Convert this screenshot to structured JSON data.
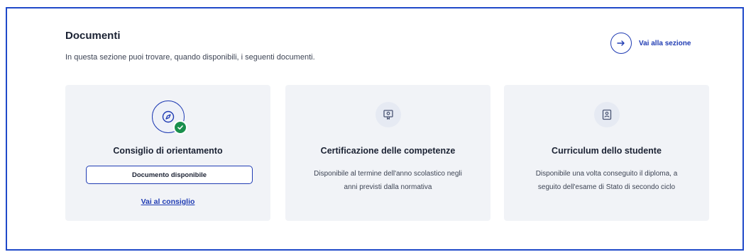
{
  "section": {
    "title": "Documenti",
    "subtitle": "In questa sezione puoi trovare, quando disponibili, i seguenti documenti.",
    "link_label": "Vai alla sezione"
  },
  "cards": [
    {
      "title": "Consiglio di orientamento",
      "status_label": "Documento disponibile",
      "link_label": "Vai al consiglio",
      "icon": "compass-icon",
      "available": true
    },
    {
      "title": "Certificazione delle competenze",
      "description": "Disponibile al termine dell'anno scolastico negli anni previsti dalla normativa",
      "icon": "certificate-icon"
    },
    {
      "title": "Curriculum dello studente",
      "description": "Disponibile una volta conseguito il diploma, a seguito dell'esame di Stato di secondo ciclo",
      "icon": "profile-document-icon"
    }
  ],
  "colors": {
    "accent": "#1f3bb3",
    "card_bg": "#f1f3f7",
    "success": "#1a8f4d",
    "frame_border": "#1f49c9"
  }
}
